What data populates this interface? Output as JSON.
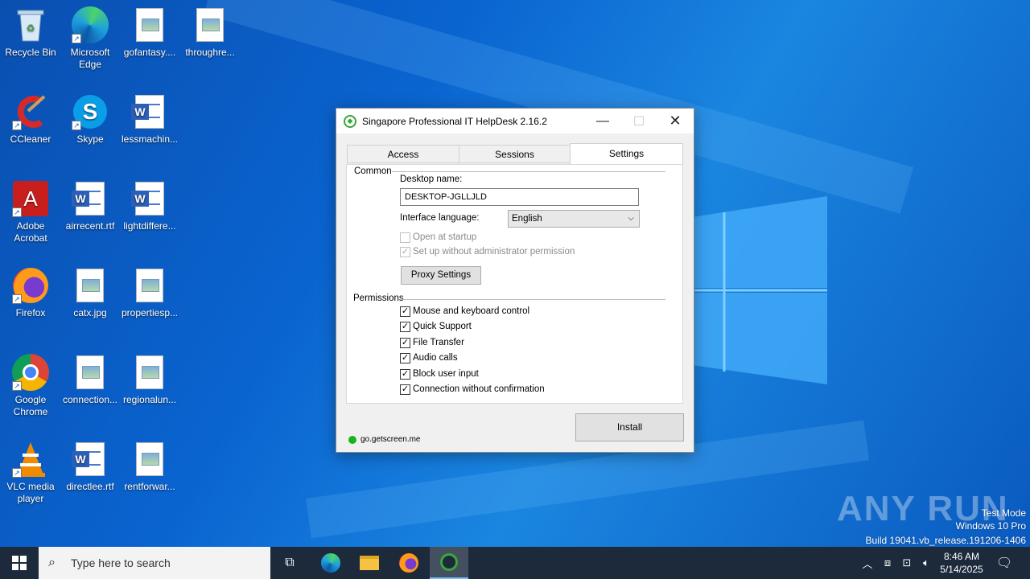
{
  "desktop": {
    "icons": [
      {
        "label": "Recycle Bin",
        "icon": "recycle-bin-icon"
      },
      {
        "label": "Microsoft Edge",
        "icon": "edge-icon"
      },
      {
        "label": "gofantasy....",
        "icon": "image-file-icon"
      },
      {
        "label": "throughre...",
        "icon": "image-file-icon"
      },
      {
        "label": "CCleaner",
        "icon": "ccleaner-icon"
      },
      {
        "label": "Skype",
        "icon": "skype-icon"
      },
      {
        "label": "lessmachin...",
        "icon": "word-doc-icon"
      },
      {
        "label": "Adobe Acrobat",
        "icon": "acrobat-icon"
      },
      {
        "label": "airrecent.rtf",
        "icon": "word-doc-icon"
      },
      {
        "label": "lightdiffere...",
        "icon": "word-doc-icon"
      },
      {
        "label": "Firefox",
        "icon": "firefox-icon"
      },
      {
        "label": "catx.jpg",
        "icon": "image-file-icon"
      },
      {
        "label": "propertiesp...",
        "icon": "image-file-icon"
      },
      {
        "label": "Google Chrome",
        "icon": "chrome-icon"
      },
      {
        "label": "connection...",
        "icon": "image-file-icon"
      },
      {
        "label": "regionalun...",
        "icon": "image-file-icon"
      },
      {
        "label": "VLC media player",
        "icon": "vlc-icon"
      },
      {
        "label": "directlee.rtf",
        "icon": "word-doc-icon"
      },
      {
        "label": "rentforwar...",
        "icon": "image-file-icon"
      }
    ]
  },
  "window": {
    "title": "Singapore Professional IT HelpDesk 2.16.2",
    "tabs": [
      "Access",
      "Sessions",
      "Settings"
    ],
    "active_tab": "Settings",
    "common": {
      "group_title": "Common",
      "desktop_name_label": "Desktop name:",
      "desktop_name_value": "DESKTOP-JGLLJLD",
      "language_label": "Interface language:",
      "language_value": "English",
      "open_at_startup": {
        "label": "Open at startup",
        "checked": false
      },
      "setup_without_admin": {
        "label": "Set up without administrator permission",
        "checked": true
      },
      "proxy_button": "Proxy Settings"
    },
    "permissions": {
      "group_title": "Permissions",
      "items": [
        {
          "label": "Mouse and keyboard control",
          "checked": true
        },
        {
          "label": "Quick Support",
          "checked": true
        },
        {
          "label": "File Transfer",
          "checked": true
        },
        {
          "label": "Audio calls",
          "checked": true
        },
        {
          "label": "Block user input",
          "checked": true
        },
        {
          "label": "Connection without confirmation",
          "checked": true
        }
      ]
    },
    "install_button": "Install",
    "status_text": "go.getscreen.me",
    "status_color": "#18b418"
  },
  "taskbar": {
    "search_placeholder": "Type here to search",
    "time": "8:46 AM",
    "date": "5/14/2025"
  },
  "watermark": {
    "line1": "Test Mode",
    "line2": "Windows 10 Pro",
    "line3": "Build 19041.vb_release.191206-1406",
    "brand": "ANY RUN"
  }
}
